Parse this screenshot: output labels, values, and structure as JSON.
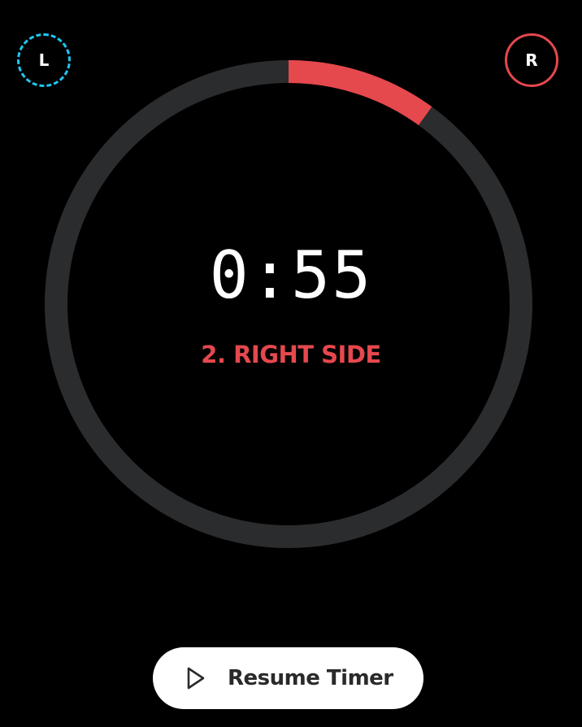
{
  "badges": {
    "left": {
      "label": "L",
      "color": "#1ec8f0",
      "style": "dashed"
    },
    "right": {
      "label": "R",
      "color": "#e5484d",
      "style": "solid"
    }
  },
  "timer": {
    "display": "0:55",
    "phase_label": "2. RIGHT SIDE",
    "progress_fraction": 0.1,
    "ring_track_color": "#2b2c2e",
    "ring_progress_color": "#e5484d"
  },
  "controls": {
    "resume_label": "Resume Timer",
    "resume_icon": "play-icon"
  }
}
